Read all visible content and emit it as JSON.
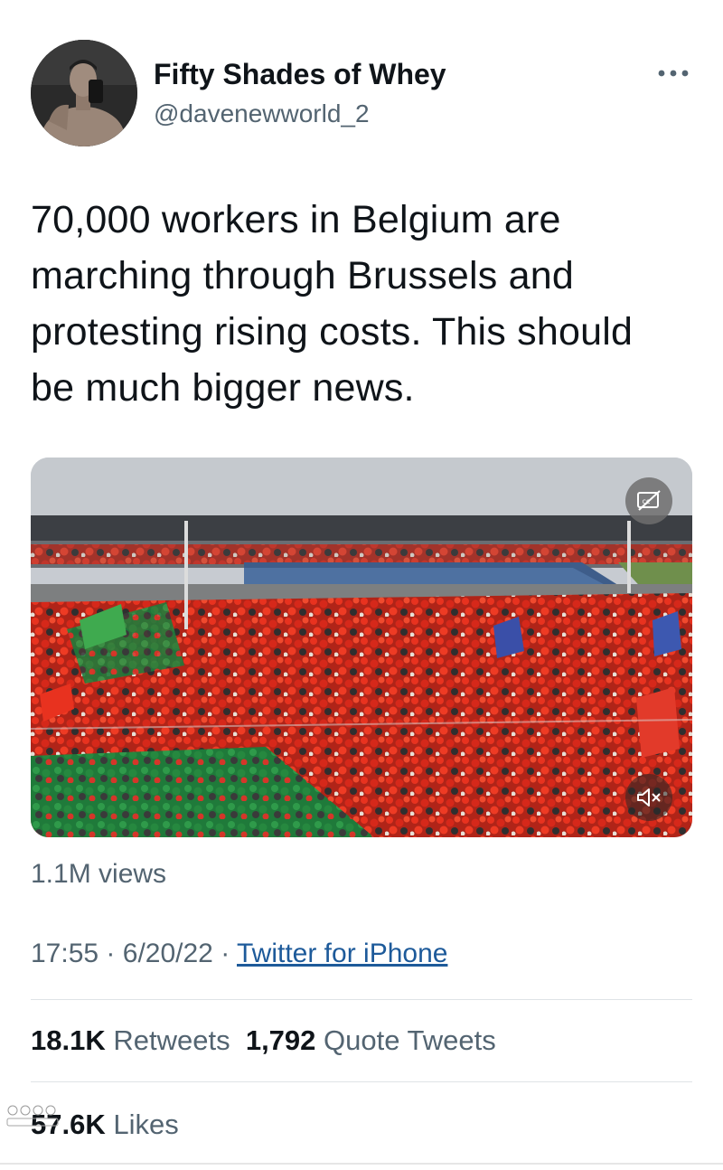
{
  "author": {
    "display_name": "Fifty Shades of Whey",
    "handle": "@davenewworld_2"
  },
  "tweet": {
    "text_lines": [
      "70,000 workers in Belgium are",
      "marching through Brussels and",
      "protesting rising costs. This should",
      "be much bigger news."
    ]
  },
  "media": {
    "cc_icon": "closed-captions-icon",
    "mute_icon": "speaker-muted-icon"
  },
  "meta": {
    "views": "1.1M views",
    "time": "17:55",
    "separator": "·",
    "date": "6/20/22",
    "source": "Twitter for iPhone"
  },
  "stats": {
    "retweets_count": "18.1K",
    "retweets_label": "Retweets",
    "quotes_count": "1,792",
    "quotes_label": "Quote Tweets",
    "likes_count": "57.6K",
    "likes_label": "Likes"
  },
  "colors": {
    "text": "#0f1419",
    "secondary": "#536471",
    "link": "#1d5a9a"
  }
}
